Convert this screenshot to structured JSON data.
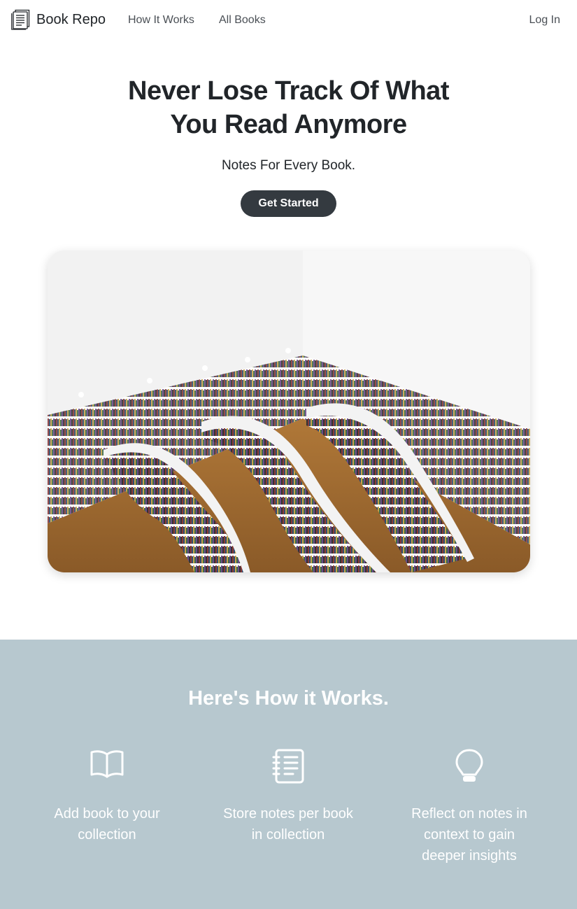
{
  "nav": {
    "brand": "Book Repo",
    "brand_icon": "book-logo-icon",
    "links": [
      "How It Works",
      "All Books"
    ],
    "login": "Log In"
  },
  "hero": {
    "title_line1": "Never Lose Track Of What",
    "title_line2": "You Read Anymore",
    "subtitle": "Notes For Every Book.",
    "cta": "Get Started",
    "image_alt": "library-bookshelves-photo"
  },
  "how": {
    "title": "Here's How it Works.",
    "steps": [
      {
        "icon": "open-book-icon",
        "text_line1": "Add book to your",
        "text_line2": "collection",
        "text_line3": ""
      },
      {
        "icon": "notebook-icon",
        "text_line1": "Store notes per book",
        "text_line2": "in collection",
        "text_line3": ""
      },
      {
        "icon": "lightbulb-icon",
        "text_line1": "Reflect on notes in",
        "text_line2": "context to gain",
        "text_line3": "deeper insights"
      }
    ]
  },
  "colors": {
    "how_bg": "#b7c8cf",
    "cta_bg": "#343a40",
    "text": "#212529"
  }
}
